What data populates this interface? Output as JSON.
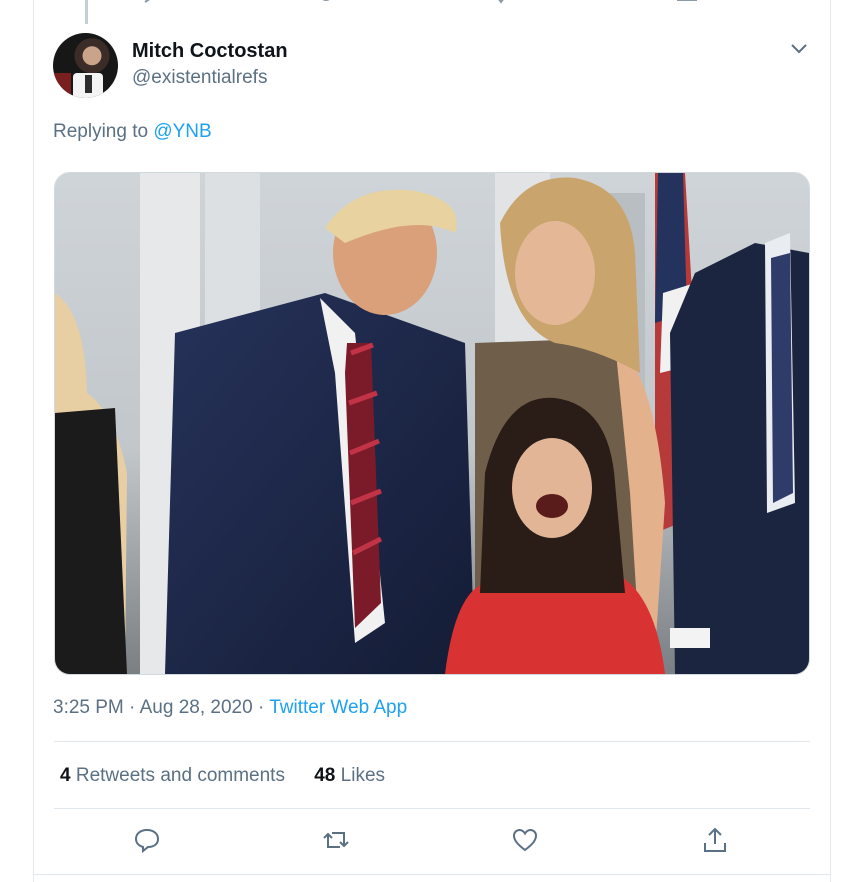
{
  "tweet": {
    "author_name": "Mitch Coctostan",
    "author_handle": "@existentialrefs",
    "replying_prefix": "Replying to",
    "replying_to": "@YNB",
    "time": "3:25 PM",
    "date": "Aug 28, 2020",
    "source": "Twitter Web App",
    "retweets_count": "4",
    "retweets_label": "Retweets and comments",
    "likes_count": "48",
    "likes_label": "Likes"
  },
  "icons": {
    "menu": "chevron-down-icon",
    "actions": [
      "reply-icon",
      "retweet-icon",
      "like-icon",
      "share-icon"
    ]
  },
  "colors": {
    "accent": "#1da1f2",
    "secondary_text": "#5b7083",
    "border": "#e1e8ed"
  }
}
